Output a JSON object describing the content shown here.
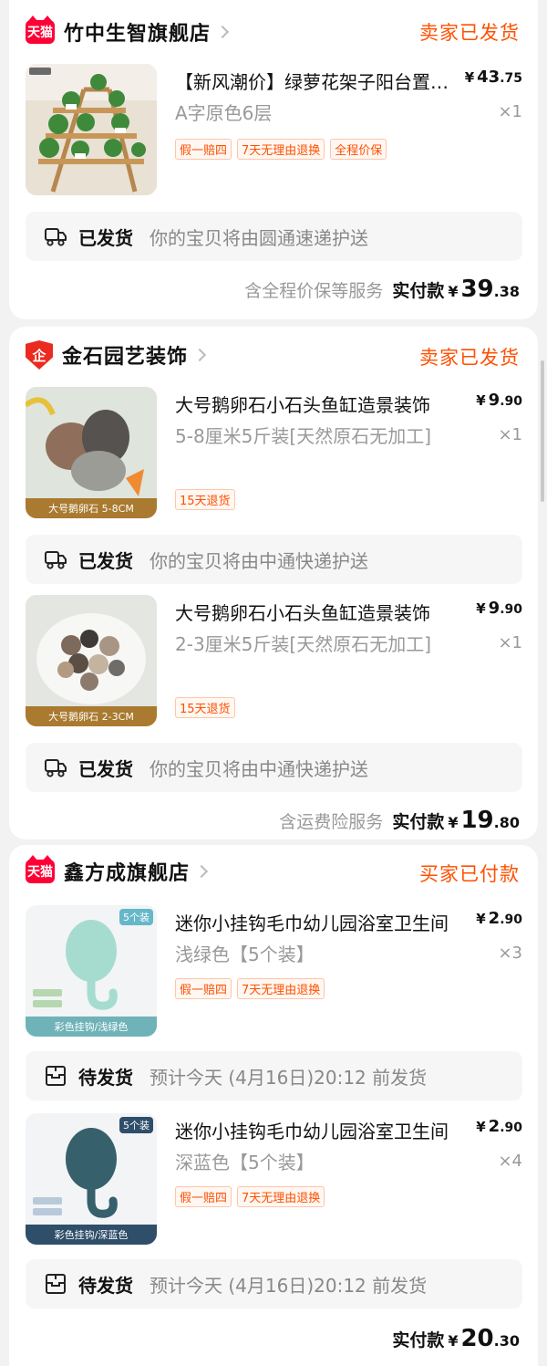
{
  "stores": [
    {
      "name": "竹中生智旗舰店",
      "badge": "天猫",
      "status": "卖家已发货",
      "items": [
        {
          "title": "【新风潮价】绿萝花架子阳台置物架",
          "sku": "A字原色6层",
          "price_int": "43",
          "price_dec": ".75",
          "qty": "×1",
          "tags": [
            "假一赔四",
            "7天无理由退换",
            "全程价保"
          ],
          "shipping": {
            "label": "已发货",
            "desc": "你的宝贝将由圆通速递护送"
          }
        }
      ],
      "summary": {
        "service": "含全程价保等服务",
        "paid_label": "实付款",
        "yen": "¥",
        "int": "39",
        "dec": ".38"
      }
    },
    {
      "name": "金石园艺装饰",
      "badge": "企",
      "status": "卖家已发货",
      "items": [
        {
          "title": "大号鹅卵石小石头鱼缸造景装饰",
          "sku": "5-8厘米5斤装[天然原石无加工]",
          "price_int": "9",
          "price_dec": ".90",
          "qty": "×1",
          "thumb_band": "大号鹅卵石 5-8CM",
          "tags": [
            "15天退货"
          ],
          "shipping": {
            "label": "已发货",
            "desc": "你的宝贝将由中通快递护送"
          }
        },
        {
          "title": "大号鹅卵石小石头鱼缸造景装饰",
          "sku": "2-3厘米5斤装[天然原石无加工]",
          "price_int": "9",
          "price_dec": ".90",
          "qty": "×1",
          "thumb_band": "大号鹅卵石 2-3CM",
          "tags": [
            "15天退货"
          ],
          "shipping": {
            "label": "已发货",
            "desc": "你的宝贝将由中通快递护送"
          }
        }
      ],
      "summary": {
        "service": "含运费险服务",
        "paid_label": "实付款",
        "yen": "¥",
        "int": "19",
        "dec": ".80"
      }
    },
    {
      "name": "鑫方成旗舰店",
      "badge": "天猫",
      "status": "买家已付款",
      "items": [
        {
          "title": "迷你小挂钩毛巾幼儿园浴室卫生间",
          "sku": "浅绿色【5个装】",
          "price_int": "2",
          "price_dec": ".90",
          "qty": "×3",
          "thumb_band": "彩色挂钩/浅绿色",
          "thumb_tag": "5个装",
          "tags": [
            "假一赔四",
            "7天无理由退换"
          ],
          "shipping": {
            "label": "待发货",
            "desc": "预计今天 (4月16日)20:12 前发货"
          }
        },
        {
          "title": "迷你小挂钩毛巾幼儿园浴室卫生间",
          "sku": "深蓝色【5个装】",
          "price_int": "2",
          "price_dec": ".90",
          "qty": "×4",
          "thumb_band": "彩色挂钩/深蓝色",
          "thumb_tag": "5个装",
          "tags": [
            "假一赔四",
            "7天无理由退换"
          ],
          "shipping": {
            "label": "待发货",
            "desc": "预计今天 (4月16日)20:12 前发货"
          }
        }
      ],
      "summary": {
        "service": "",
        "paid_label": "实付款",
        "yen": "¥",
        "int": "20",
        "dec": ".30"
      }
    }
  ],
  "colors": {
    "accent": "#ff5000",
    "tmall": "#ff0036",
    "enterprise": "#ea2b1f"
  },
  "icons": {
    "shipped": "truck-icon",
    "pending": "package-icon"
  }
}
